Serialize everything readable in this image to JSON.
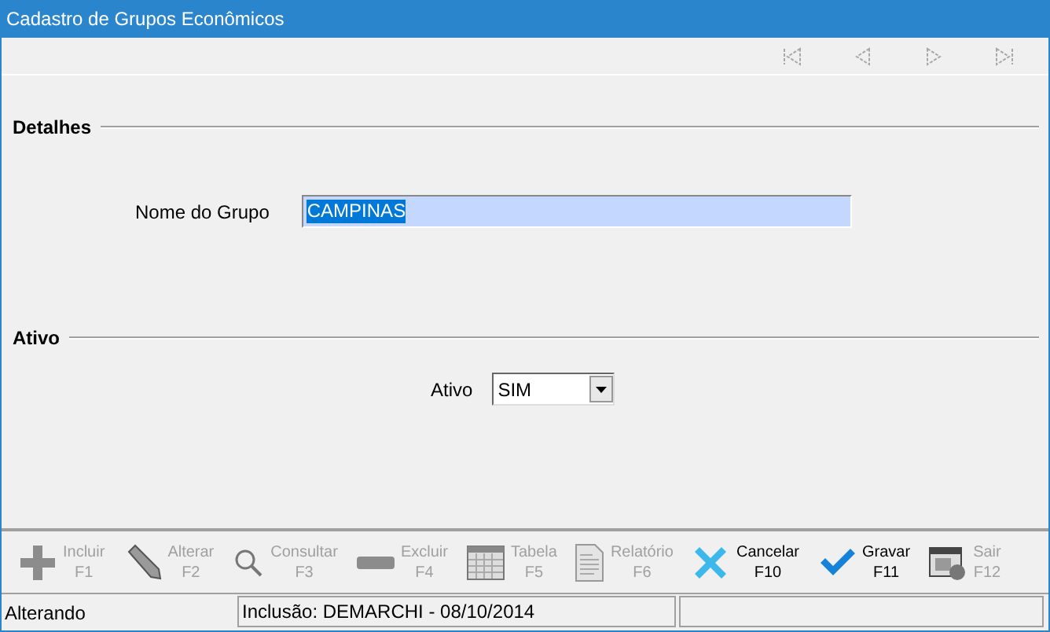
{
  "window": {
    "title": "Cadastro de Grupos Econômicos"
  },
  "navigation": [
    {
      "kind": "first",
      "disabled": true
    },
    {
      "kind": "prev",
      "disabled": true
    },
    {
      "kind": "next",
      "disabled": true
    },
    {
      "kind": "last",
      "disabled": true
    }
  ],
  "sections": [
    {
      "title": "Detalhes",
      "field": {
        "kind": "text",
        "label": "Nome do Grupo",
        "value": "CAMPINAS",
        "selected": true
      }
    },
    {
      "title": "Ativo",
      "field": {
        "kind": "select",
        "label": "Ativo",
        "value": "SIM"
      }
    }
  ],
  "toolbar": [
    {
      "kind": "plus",
      "label": "Incluir",
      "key": "F1",
      "disabled": true
    },
    {
      "kind": "pencil",
      "label": "Alterar",
      "key": "F2",
      "disabled": true
    },
    {
      "kind": "search",
      "label": "Consultar",
      "key": "F3",
      "disabled": true
    },
    {
      "kind": "minus",
      "label": "Excluir",
      "key": "F4",
      "disabled": true
    },
    {
      "kind": "table",
      "label": "Tabela",
      "key": "F5",
      "disabled": true
    },
    {
      "kind": "report",
      "label": "Relatório",
      "key": "F6",
      "disabled": true
    },
    {
      "kind": "cancel",
      "label": "Cancelar",
      "key": "F10",
      "disabled": false
    },
    {
      "kind": "save",
      "label": "Gravar",
      "key": "F11",
      "disabled": false
    },
    {
      "kind": "exit",
      "label": "Sair",
      "key": "F12",
      "disabled": true
    }
  ],
  "status_bar": {
    "mode": "Alterando",
    "info": "Inclusão: DEMARCHI - 08/10/2014"
  }
}
